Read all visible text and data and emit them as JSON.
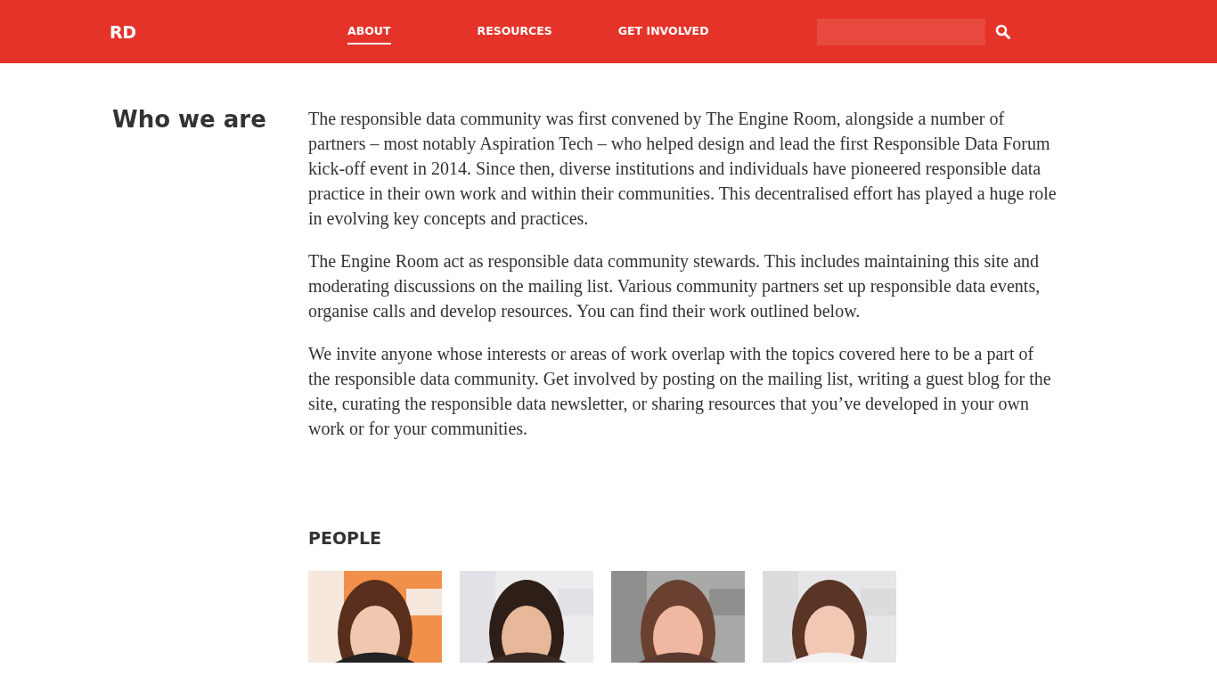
{
  "header": {
    "logo": "RD",
    "nav": [
      {
        "label": "ABOUT",
        "selected": true
      },
      {
        "label": "RESOURCES",
        "selected": false
      },
      {
        "label": "GET INVOLVED",
        "selected": false
      }
    ]
  },
  "section": {
    "heading": "Who we are",
    "paragraphs": [
      "The responsible data community was first convened by The Engine Room, alongside a number of partners – most notably Aspiration Tech – who helped design and lead the first Responsible Data Forum kick-off event in 2014. Since then, diverse institutions and individuals have pioneered responsible data practice in their own work and within their communities. This decentralised effort has played a huge role in evolving key concepts and practices.",
      "The Engine Room act as responsible data community stewards. This includes maintaining this site and moderating discussions on the mailing list. Various community partners set up responsible data events, organise calls and develop resources. You can find their work outlined below.",
      "We invite anyone whose interests or areas of work overlap with the topics covered here to be a part of the responsible data community. Get involved by posting on the mailing list, writing a guest blog for the site, curating the responsible data newsletter, or sharing resources that you’ve developed in your own work or for your communities."
    ]
  },
  "people": {
    "heading": "PEOPLE"
  }
}
